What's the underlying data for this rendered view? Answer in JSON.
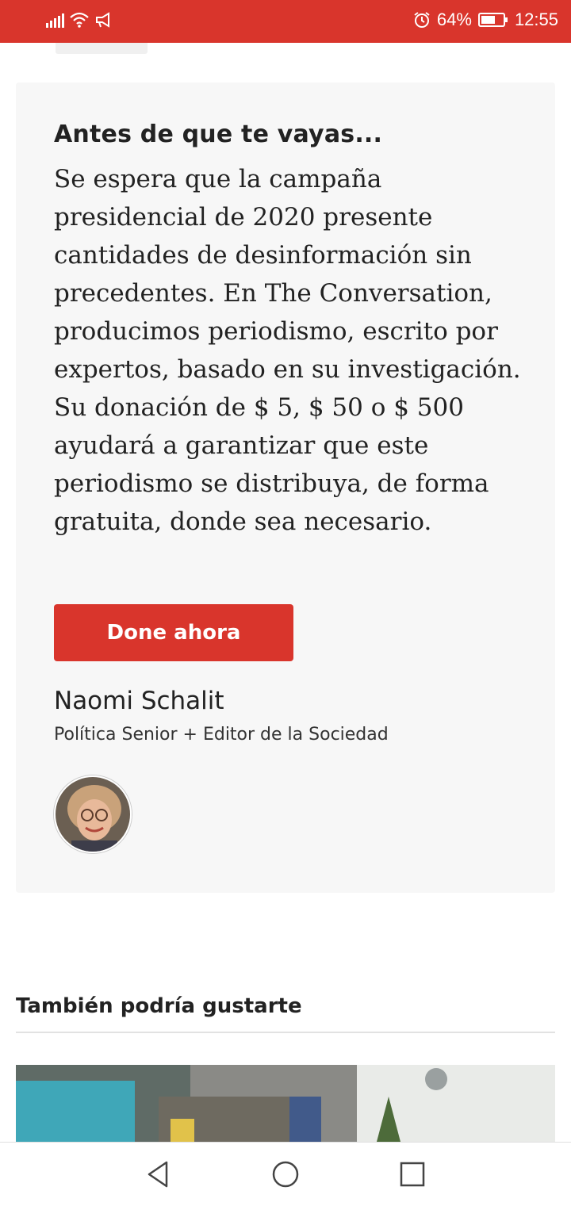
{
  "status_bar": {
    "battery_percent": "64%",
    "battery_level": 0.64,
    "time": "12:55",
    "icons": [
      "signal-icon",
      "wifi-icon",
      "megaphone-icon",
      "alarm-icon",
      "battery-icon"
    ]
  },
  "donation_card": {
    "title": "Antes de que te vayas...",
    "body": "Se espera que la campaña presidencial de 2020 presente cantidades de desinformación sin precedentes. En The Conversation, producimos periodismo, escrito por expertos, basado en su investigación. Su donación de $ 5, $ 50 o $ 500 ayudará a garantizar que este periodismo se distribuya, de forma gratuita, donde sea necesario.",
    "button_label": "Done ahora",
    "author_name": "Naomi Schalit",
    "author_role": "Política Senior + Editor de la Sociedad"
  },
  "related": {
    "title": "También podría gustarte"
  },
  "nav_bar": {
    "icons": [
      "back-icon",
      "home-icon",
      "recents-icon"
    ]
  },
  "colors": {
    "accent": "#d9352c",
    "card_bg": "#f7f7f7",
    "text": "#222222"
  }
}
